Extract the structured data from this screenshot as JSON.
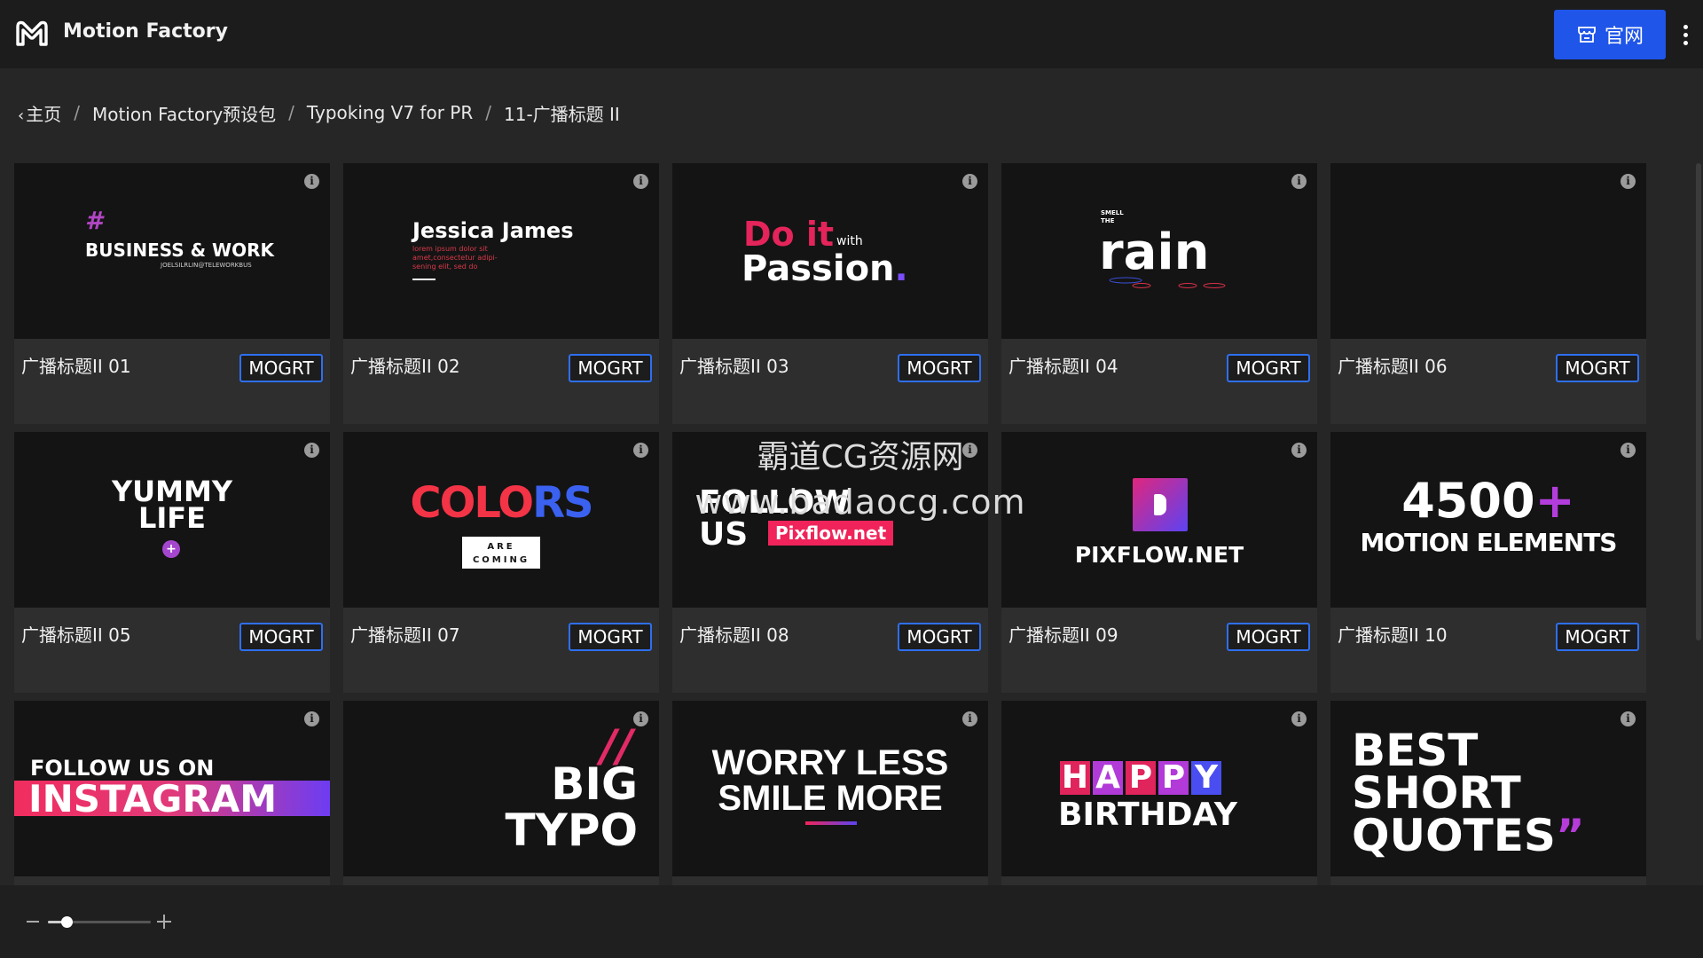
{
  "app": {
    "title": "Motion Factory",
    "official_button_label": "官网"
  },
  "breadcrumb": [
    "主页",
    "Motion Factory预设包",
    "Typoking V7 for PR",
    "11-广播标题 II"
  ],
  "grid": {
    "badge_label": "MOGRT",
    "cards": [
      {
        "title": "广播标题II 01",
        "art": [
          "#",
          "BUSINESS & WORK",
          "JOELSILRLIN@TELEWORKBUS"
        ]
      },
      {
        "title": "广播标题II 02",
        "art": [
          "Jessica James",
          "lorem ipsum dolor sit",
          "amet,consectetur adipi-",
          "sening elit, sed do"
        ]
      },
      {
        "title": "广播标题II 03",
        "art": [
          "Do it",
          "with",
          "Passion",
          "."
        ]
      },
      {
        "title": "广播标题II 04",
        "art": [
          "SMELL",
          "THE",
          "rain"
        ]
      },
      {
        "title": "广播标题II 06",
        "art": []
      },
      {
        "title": "广播标题II 05",
        "art": [
          "YUMMY",
          "LIFE",
          "+"
        ]
      },
      {
        "title": "广播标题II 07",
        "art": [
          "COLO",
          "RS",
          "ARE",
          "COMING"
        ]
      },
      {
        "title": "广播标题II 08",
        "art": [
          "FOLLOW",
          "US",
          "Pixflow.net"
        ]
      },
      {
        "title": "广播标题II 09",
        "art": [
          "PIXFLOW.NET"
        ]
      },
      {
        "title": "广播标题II 10",
        "art": [
          "4500",
          "+",
          "MOTION ELEMENTS"
        ]
      },
      {
        "title": "",
        "art": [
          "FOLLOW US ON",
          "INSTAGRAM"
        ]
      },
      {
        "title": "",
        "art": [
          "/",
          "/",
          "BIG",
          "TYPO"
        ]
      },
      {
        "title": "",
        "art": [
          "WORRY LESS",
          "SMILE MORE"
        ]
      },
      {
        "title": "",
        "art": [
          "H",
          "A",
          "P",
          "P",
          "Y",
          "BIRTHDAY"
        ]
      },
      {
        "title": "",
        "art": [
          "BEST",
          "SHORT",
          "QUOTES",
          "”"
        ]
      }
    ]
  },
  "watermark": {
    "line1": "霸道CG资源网",
    "line2": "www.badaocg.com"
  },
  "zoom": {
    "minus_label": "−",
    "plus_label": "+",
    "level": 0.18
  },
  "colors": {
    "accent": "#1f55e8",
    "badge_border": "#2e6ff0",
    "background": "#262626",
    "topbar": "#1c1c1c"
  }
}
